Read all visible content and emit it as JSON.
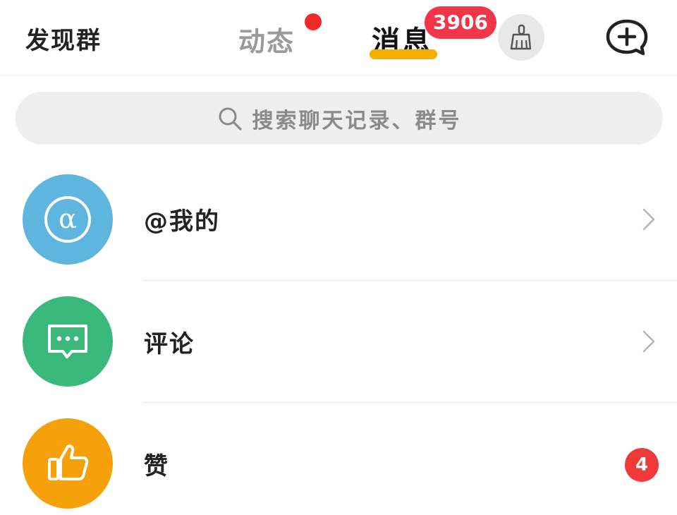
{
  "header": {
    "discover_label": "发现群",
    "tabs": [
      {
        "label": "动态",
        "active": false,
        "has_dot": true
      },
      {
        "label": "消息",
        "active": true
      }
    ],
    "message_count": "3906",
    "icons": {
      "clean": "broom-icon",
      "new_chat": "add-chat-icon"
    }
  },
  "search": {
    "placeholder": "搜索聊天记录、群号",
    "icon": "search-icon"
  },
  "list": [
    {
      "label": "@我的",
      "icon": "at-icon",
      "color": "#5eb6df",
      "has_chevron": true
    },
    {
      "label": "评论",
      "icon": "comment-icon",
      "color": "#3bb87b",
      "has_chevron": true
    },
    {
      "label": "赞",
      "icon": "thumbs-up-icon",
      "color": "#f7a10a",
      "badge": "4"
    }
  ],
  "colors": {
    "accent_underline": "#f4ae00",
    "badge_red": "#f2364a"
  }
}
